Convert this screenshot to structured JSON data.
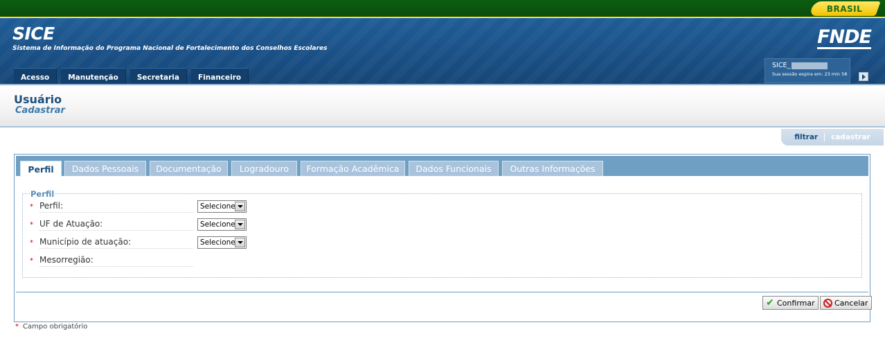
{
  "gov_bar": {
    "badge": "BRASIL"
  },
  "header": {
    "app_title": "SICE",
    "app_subtitle": "Sistema de Informação do Programa Nacional de Fortalecimento dos Conselhos Escolares",
    "logo": "FNDE",
    "menu": [
      {
        "label": "Acesso"
      },
      {
        "label": "Manutenção"
      },
      {
        "label": "Secretaria"
      },
      {
        "label": "Financeiro"
      }
    ],
    "session": {
      "user": "SICE_",
      "expires": "Sua sessão expira em: 23 min 58"
    }
  },
  "page": {
    "title": "Usuário",
    "subtitle": "Cadastrar"
  },
  "actions": {
    "filtrar": "filtrar",
    "cadastrar": "cadastrar"
  },
  "tabs": [
    {
      "label": "Perfil",
      "active": true
    },
    {
      "label": "Dados Pessoais"
    },
    {
      "label": "Documentação"
    },
    {
      "label": "Logradouro"
    },
    {
      "label": "Formação Acadêmica"
    },
    {
      "label": "Dados Funcionais"
    },
    {
      "label": "Outras Informações"
    }
  ],
  "form": {
    "legend": "Perfil",
    "required_marker": "*",
    "fields": [
      {
        "label": "Perfil:",
        "value": "Selecione"
      },
      {
        "label": "UF de Atuação:",
        "value": "Selecione"
      },
      {
        "label": "Município de atuação:",
        "value": "Selecione"
      },
      {
        "label": "Mesorregião:"
      }
    ],
    "confirm_label": "Confirmar",
    "cancel_label": "Cancelar"
  },
  "footnote": "Campo obrigatório",
  "colors": {
    "gov_green": "#0b5510",
    "header_blue": "#1f5d97",
    "tab_bar": "#6f9fc3",
    "required_red": "#c00000"
  }
}
